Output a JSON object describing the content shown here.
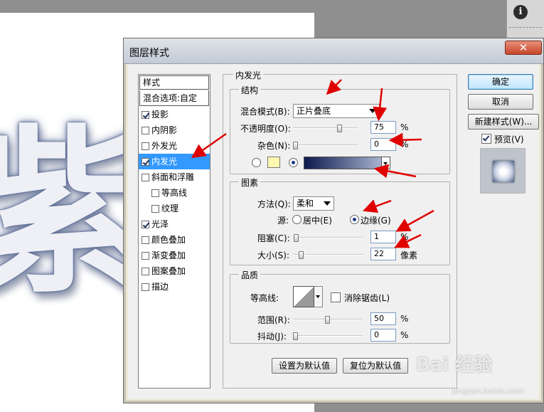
{
  "canvas": {
    "character": "紫"
  },
  "right_panel": {
    "info_glyph": "i"
  },
  "dialog": {
    "title": "图层样式",
    "close_glyph": "✕",
    "styles_list": {
      "header": "样式",
      "blend_options": "混合选项:自定",
      "items": [
        {
          "label": "投影",
          "checked": true
        },
        {
          "label": "内阴影",
          "checked": false
        },
        {
          "label": "外发光",
          "checked": false
        },
        {
          "label": "内发光",
          "checked": true,
          "selected": true
        },
        {
          "label": "斜面和浮雕",
          "checked": false
        },
        {
          "label": "等高线",
          "checked": false,
          "indent": true
        },
        {
          "label": "纹理",
          "checked": false,
          "indent": true
        },
        {
          "label": "光泽",
          "checked": true
        },
        {
          "label": "颜色叠加",
          "checked": false
        },
        {
          "label": "渐变叠加",
          "checked": false
        },
        {
          "label": "图案叠加",
          "checked": false
        },
        {
          "label": "描边",
          "checked": false
        }
      ]
    },
    "inner_glow": {
      "title": "内发光",
      "structure": {
        "title": "结构",
        "blend_mode_label": "混合模式(B):",
        "blend_mode_value": "正片叠底",
        "opacity_label": "不透明度(O):",
        "opacity_value": "75",
        "opacity_fraction": 0.75,
        "noise_label": "杂色(N):",
        "noise_value": "0",
        "noise_fraction": 0,
        "percent": "%",
        "swatch_color": "#fff8b0"
      },
      "elements": {
        "title": "图素",
        "technique_label": "方法(Q):",
        "technique_value": "柔和",
        "source_label": "源:",
        "center_label": "居中(E)",
        "edge_label": "边缘(G)",
        "choke_label": "阻塞(C):",
        "choke_value": "1",
        "choke_fraction": 0.01,
        "size_label": "大小(S):",
        "size_value": "22",
        "size_fraction": 0.088,
        "percent": "%",
        "pixels": "像素"
      },
      "quality": {
        "title": "品质",
        "contour_label": "等高线:",
        "antialias_label": "消除锯齿(L)",
        "range_label": "范围(R):",
        "range_value": "50",
        "range_fraction": 0.5,
        "jitter_label": "抖动(J):",
        "jitter_value": "0",
        "jitter_fraction": 0,
        "percent": "%"
      },
      "make_default": "设置为默认值",
      "reset_default": "复位为默认值"
    },
    "buttons": {
      "ok": "确定",
      "cancel": "取消",
      "new_style": "新建样式(W)...",
      "preview": "预览(V)"
    }
  },
  "watermark": {
    "text": "Bai 经验",
    "sub": "jingyan.baidu.com"
  }
}
